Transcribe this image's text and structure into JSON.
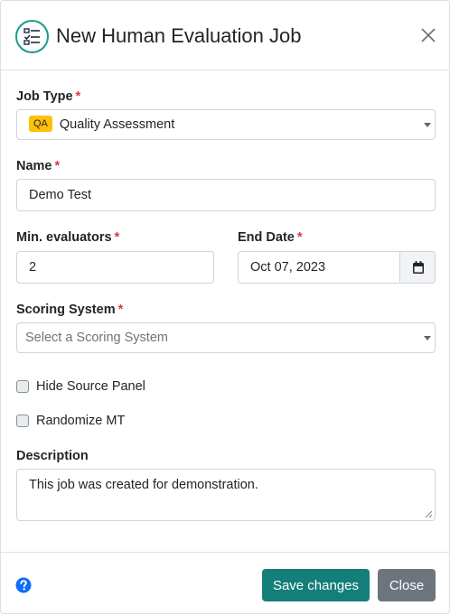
{
  "header": {
    "title": "New Human Evaluation Job",
    "icon": "checklist-icon",
    "icon_color": "#1d9a8f"
  },
  "form": {
    "job_type": {
      "label": "Job Type",
      "required_mark": "*",
      "badge": "QA",
      "value": "Quality Assessment"
    },
    "name": {
      "label": "Name",
      "required_mark": "*",
      "value": "Demo Test"
    },
    "min_evaluators": {
      "label": "Min. evaluators",
      "required_mark": "*",
      "value": "2"
    },
    "end_date": {
      "label": "End Date",
      "required_mark": "*",
      "value": "Oct 07, 2023",
      "icon": "calendar-icon"
    },
    "scoring_system": {
      "label": "Scoring System",
      "required_mark": "*",
      "placeholder": "Select a Scoring System"
    },
    "hide_source_panel": {
      "label": "Hide Source Panel",
      "checked": false
    },
    "randomize_mt": {
      "label": "Randomize MT",
      "checked": false
    },
    "description": {
      "label": "Description",
      "value": "This job was created for demonstration."
    }
  },
  "footer": {
    "help_icon": "question-circle-icon",
    "save_label": "Save changes",
    "close_label": "Close"
  },
  "colors": {
    "primary": "#147e7a",
    "secondary": "#6c757d",
    "required": "#dc3545",
    "badge": "#ffc107",
    "help": "#0d6efd"
  }
}
